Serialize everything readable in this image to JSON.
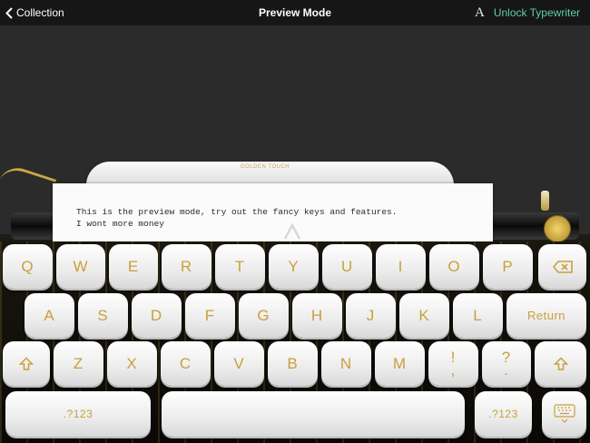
{
  "nav": {
    "back_label": "Collection",
    "title": "Preview Mode",
    "font_icon_label": "A",
    "unlock_label": "Unlock Typewriter"
  },
  "typewriter": {
    "brand": "GOLDEN TOUCH",
    "paper_lines": [
      "This is the preview mode, try out the fancy keys and features.",
      "I wont more money"
    ]
  },
  "keyboard": {
    "row1": [
      "Q",
      "W",
      "E",
      "R",
      "T",
      "Y",
      "U",
      "I",
      "O",
      "P"
    ],
    "row2": [
      "A",
      "S",
      "D",
      "F",
      "G",
      "H",
      "J",
      "K",
      "L"
    ],
    "return_label": "Return",
    "row3": [
      "Z",
      "X",
      "C",
      "V",
      "B",
      "N",
      "M"
    ],
    "exclaim_label": "!",
    "exclaim_sub": ",",
    "question_label": "?",
    "question_sub": ".",
    "numbers_label_left": ".?123",
    "numbers_label_right": ".?123"
  },
  "colors": {
    "accent": "#5fcfa8",
    "key_glyph": "#c8a03c",
    "nav_bg": "#161616",
    "stage_bg": "#2b2b2b"
  }
}
